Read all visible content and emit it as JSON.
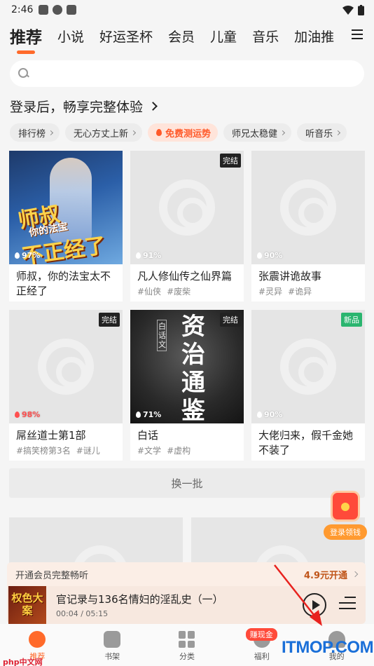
{
  "status": {
    "time": "2:46"
  },
  "tabs": [
    "推荐",
    "小说",
    "好运圣杯",
    "会员",
    "儿童",
    "音乐",
    "加油推"
  ],
  "search": {
    "placeholder": ""
  },
  "login_prompt": "登录后，畅享完整体验",
  "chips": [
    {
      "label": "排行榜",
      "hot": false
    },
    {
      "label": "无心方丈上新",
      "hot": false
    },
    {
      "label": "免费测运势",
      "hot": true
    },
    {
      "label": "师兄太稳健",
      "hot": false
    },
    {
      "label": "听音乐",
      "hot": false
    }
  ],
  "books": [
    {
      "title": "师叔，你的法宝太不正经了",
      "tags": [],
      "pct": "97%",
      "badge": "",
      "cover": "a",
      "cover_text": [
        "师叔",
        "你的法宝",
        "不正经了"
      ]
    },
    {
      "title": "凡人修仙传之仙界篇",
      "tags": [
        "#仙侠",
        "#废柴"
      ],
      "pct": "91%",
      "badge": "完结",
      "cover": "ph"
    },
    {
      "title": "张震讲诡故事",
      "tags": [
        "#灵异",
        "#诡异"
      ],
      "pct": "90%",
      "badge": "",
      "cover": "ph"
    },
    {
      "title": "屌丝道士第1部",
      "tags": [
        "#搞笑榜第3名",
        "#谜儿"
      ],
      "pct": "98%",
      "badge": "完结",
      "cover": "ph",
      "red": true
    },
    {
      "title": "白话",
      "tags": [
        "#文学",
        "#虚构"
      ],
      "pct": "71%",
      "badge": "完结",
      "cover": "b",
      "cover_text": [
        "资治通鉴",
        "白话文"
      ]
    },
    {
      "title": "大佬归来，假千金她不装了",
      "tags": [],
      "pct": "90%",
      "badge": "新品",
      "badge_green": true,
      "cover": "ph"
    }
  ],
  "refresh_label": "换一批",
  "red_packet_label": "登录领钱",
  "member_bar": {
    "text": "开通会员完整畅听",
    "price": "4.9元开通"
  },
  "player": {
    "title": "官记录与136名情妇的淫乱史（一）",
    "time": "00:04 / 05:15",
    "thumb_text": "权色大案"
  },
  "nav": [
    {
      "label": "推荐",
      "active": true
    },
    {
      "label": "书架",
      "active": false
    },
    {
      "label": "分类",
      "active": false
    },
    {
      "label": "福利",
      "active": false,
      "badge": "赚现金"
    },
    {
      "label": "我的",
      "active": false
    }
  ],
  "watermarks": {
    "left": "php中文网",
    "right": "ITMOP.COM"
  },
  "colors": {
    "accent": "#ff6a2a",
    "badge_green": "#2ab56f",
    "arrow": "#e8221e"
  }
}
